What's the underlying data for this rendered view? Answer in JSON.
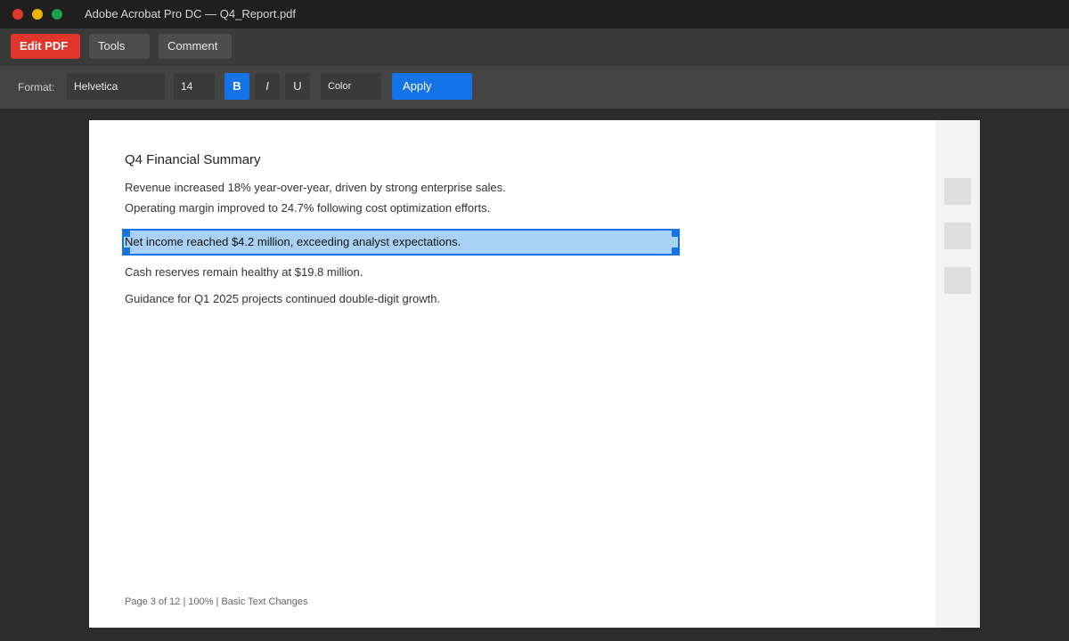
{
  "window": {
    "title": "Adobe Acrobat Pro DC — Q4_Report.pdf"
  },
  "toolbar": {
    "edit_label": "Edit PDF",
    "tools_label": "Tools",
    "comment_label": "Comment"
  },
  "format_bar": {
    "label": "Format:",
    "font": "Helvetica",
    "size": "14",
    "bold": "B",
    "italic": "I",
    "underline": "U",
    "color_label": "Color",
    "apply_label": "Apply",
    "bold_active": true
  },
  "document": {
    "title": "Q4 Financial Summary",
    "paragraphs": [
      "Revenue increased 18% year-over-year, driven by strong enterprise sales.",
      "Operating margin improved to 24.7% following cost optimization efforts.",
      "Net income reached $4.2 million, exceeding analyst expectations.",
      "Cash reserves remain healthy at $19.8 million.",
      "Guidance for Q1 2025 projects continued double-digit growth."
    ],
    "status_line": "Page 3 of 12 | 100% | Basic Text Changes"
  },
  "colors": {
    "accent": "#1473e6",
    "brand": "#e0362b",
    "selection": "#a9d1f3"
  }
}
